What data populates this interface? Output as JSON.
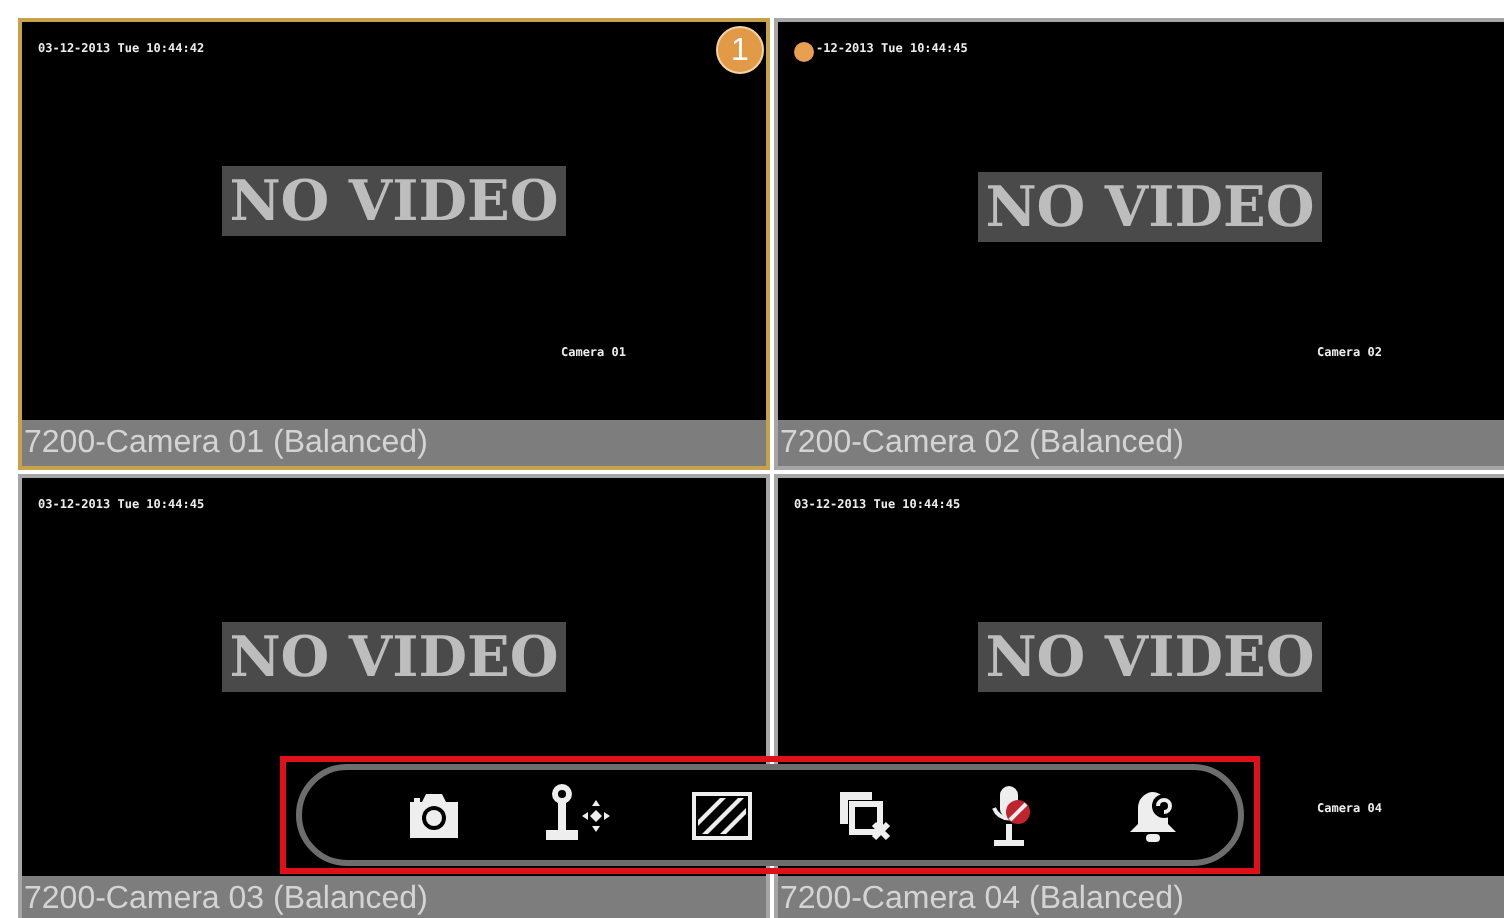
{
  "tiles": [
    {
      "label": "7200-Camera 01 (Balanced)",
      "selected": true,
      "timestamp": "03-12-2013 Tue 10:44:42",
      "overlay": "NO VIDEO",
      "camera_name": "Camera 01",
      "badge": "1",
      "recording": false
    },
    {
      "label": "7200-Camera 02 (Balanced)",
      "selected": false,
      "timestamp": "-12-2013 Tue 10:44:45",
      "overlay": "NO VIDEO",
      "camera_name": "Camera 02",
      "recording": true
    },
    {
      "label": "7200-Camera 03 (Balanced)",
      "selected": false,
      "timestamp": "03-12-2013 Tue 10:44:45",
      "overlay": "NO VIDEO",
      "recording": false
    },
    {
      "label": "7200-Camera 04 (Balanced)",
      "selected": false,
      "timestamp": "03-12-2013 Tue 10:44:45",
      "overlay": "NO VIDEO",
      "camera_name": "Camera 04",
      "recording": false
    }
  ],
  "toolbar": {
    "highlighted": true,
    "tools": [
      {
        "kind": "snapshot"
      },
      {
        "kind": "ptz"
      },
      {
        "kind": "image"
      },
      {
        "kind": "close"
      },
      {
        "kind": "mic-muted"
      },
      {
        "kind": "alarm"
      }
    ]
  }
}
